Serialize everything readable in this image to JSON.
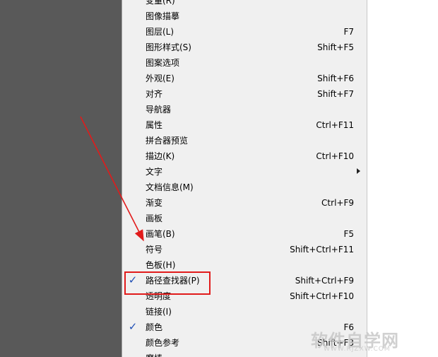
{
  "menu": {
    "items": [
      {
        "label": "变量(R)",
        "shortcut": "",
        "checked": false,
        "submenu": false
      },
      {
        "label": "图像描摹",
        "shortcut": "",
        "checked": false,
        "submenu": false
      },
      {
        "label": "图层(L)",
        "shortcut": "F7",
        "checked": false,
        "submenu": false
      },
      {
        "label": "图形样式(S)",
        "shortcut": "Shift+F5",
        "checked": false,
        "submenu": false
      },
      {
        "label": "图案选项",
        "shortcut": "",
        "checked": false,
        "submenu": false
      },
      {
        "label": "外观(E)",
        "shortcut": "Shift+F6",
        "checked": false,
        "submenu": false
      },
      {
        "label": "对齐",
        "shortcut": "Shift+F7",
        "checked": false,
        "submenu": false
      },
      {
        "label": "导航器",
        "shortcut": "",
        "checked": false,
        "submenu": false
      },
      {
        "label": "属性",
        "shortcut": "Ctrl+F11",
        "checked": false,
        "submenu": false
      },
      {
        "label": "拼合器预览",
        "shortcut": "",
        "checked": false,
        "submenu": false
      },
      {
        "label": "描边(K)",
        "shortcut": "Ctrl+F10",
        "checked": false,
        "submenu": false
      },
      {
        "label": "文字",
        "shortcut": "",
        "checked": false,
        "submenu": true
      },
      {
        "label": "文档信息(M)",
        "shortcut": "",
        "checked": false,
        "submenu": false
      },
      {
        "label": "渐变",
        "shortcut": "Ctrl+F9",
        "checked": false,
        "submenu": false
      },
      {
        "label": "画板",
        "shortcut": "",
        "checked": false,
        "submenu": false
      },
      {
        "label": "画笔(B)",
        "shortcut": "F5",
        "checked": false,
        "submenu": false
      },
      {
        "label": "符号",
        "shortcut": "Shift+Ctrl+F11",
        "checked": false,
        "submenu": false
      },
      {
        "label": "色板(H)",
        "shortcut": "",
        "checked": false,
        "submenu": false
      },
      {
        "label": "路径查找器(P)",
        "shortcut": "Shift+Ctrl+F9",
        "checked": true,
        "submenu": false
      },
      {
        "label": "透明度",
        "shortcut": "Shift+Ctrl+F10",
        "checked": false,
        "submenu": false
      },
      {
        "label": "链接(I)",
        "shortcut": "",
        "checked": false,
        "submenu": false
      },
      {
        "label": "颜色",
        "shortcut": "F6",
        "checked": true,
        "submenu": false
      },
      {
        "label": "颜色参考",
        "shortcut": "Shift+F3",
        "checked": false,
        "submenu": false
      },
      {
        "label": "魔棒",
        "shortcut": "",
        "checked": false,
        "submenu": false
      }
    ]
  },
  "icons": {
    "check": "checkmark-icon",
    "submenu": "chevron-right-icon"
  },
  "colors": {
    "accent_check": "#1f4fb5",
    "annotation": "#e11b1b",
    "workspace": "#595959"
  },
  "watermark": {
    "text": "软件自学网",
    "sub": "WWW.RJZXW.COM"
  }
}
